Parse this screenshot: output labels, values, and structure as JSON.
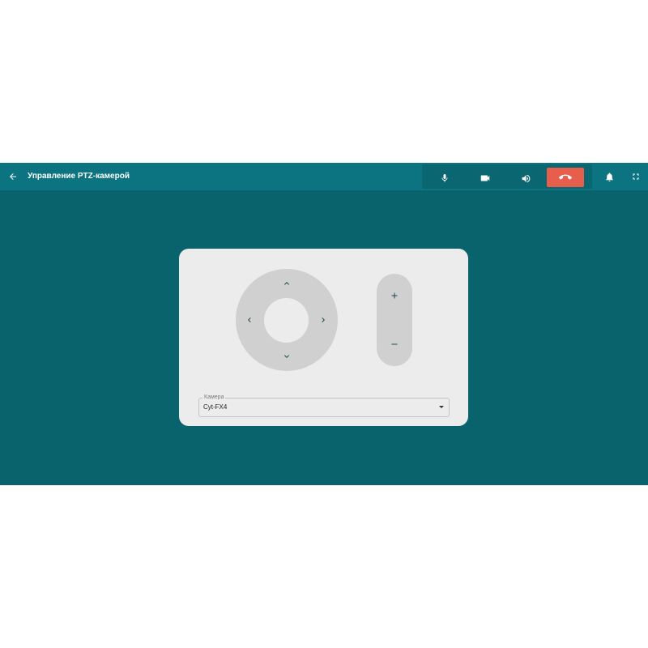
{
  "header": {
    "title": "Управление PTZ-камерой",
    "back_icon": "arrow-left-icon",
    "notifications_icon": "bell-icon",
    "fullscreen_icon": "fullscreen-icon"
  },
  "call_controls": {
    "items": [
      {
        "id": "mic",
        "icon": "microphone-icon"
      },
      {
        "id": "camera",
        "icon": "video-camera-icon"
      },
      {
        "id": "volume",
        "icon": "speaker-icon"
      },
      {
        "id": "hangup",
        "icon": "phone-hangup-icon"
      }
    ],
    "hangup_color": "#e85e4c"
  },
  "ptz": {
    "dpad": {
      "up_icon": "chevron-up-icon",
      "down_icon": "chevron-down-icon",
      "left_icon": "chevron-left-icon",
      "right_icon": "chevron-right-icon"
    },
    "zoom": {
      "plus_label": "+",
      "minus_label": "–"
    },
    "camera_select": {
      "label": "Камера",
      "value": "Cyt-FX4"
    }
  },
  "colors": {
    "topbar": "#0c7480",
    "background": "#08636c",
    "panel": "#ececec",
    "control_fill": "#d0d0d0",
    "arrow": "#1e4a4e"
  }
}
